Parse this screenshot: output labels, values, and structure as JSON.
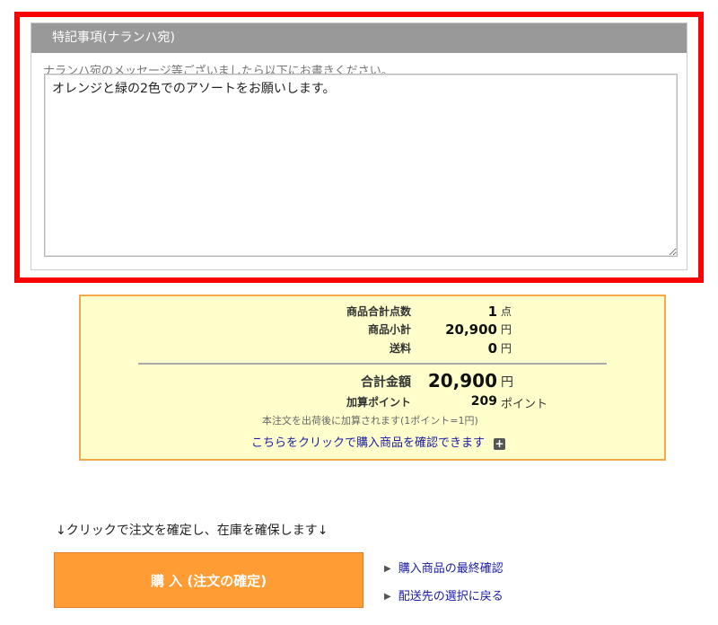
{
  "remarks": {
    "header": "特記事項(ナランハ宛)",
    "hint": "ナランハ宛のメッセージ等ございましたら以下にお書きください。",
    "text": "オレンジと緑の2色でのアソートをお願いします。"
  },
  "summary": {
    "item_count_label": "商品合計点数",
    "item_count_value": "1",
    "item_count_unit": "点",
    "subtotal_label": "商品小計",
    "subtotal_value": "20,900",
    "subtotal_unit": "円",
    "shipping_label": "送料",
    "shipping_value": "0",
    "shipping_unit": "円",
    "total_label": "合計金額",
    "total_value": "20,900",
    "total_unit": "円",
    "points_label": "加算ポイント",
    "points_value": "209",
    "points_unit": "ポイント",
    "points_note": "本注文を出荷後に加算されます(1ポイント=1円)",
    "confirm_link": "こちらをクリックで購入商品を確認できます",
    "plus_icon_glyph": "+"
  },
  "actions": {
    "instruction": "↓クリックで注文を確定し、在庫を確保します↓",
    "buy_button": "購 入 (注文の確定)",
    "final_check_link": "購入商品の最終確認",
    "back_link": "配送先の選択に戻る",
    "triangle_glyph": "▶"
  },
  "colors": {
    "highlight_border": "#ff0000",
    "header_bg": "#999999",
    "summary_bg": "#ffffcc",
    "summary_border": "#f5a84a",
    "buy_button_bg": "#ff9c33",
    "link": "#1a1aa6"
  }
}
